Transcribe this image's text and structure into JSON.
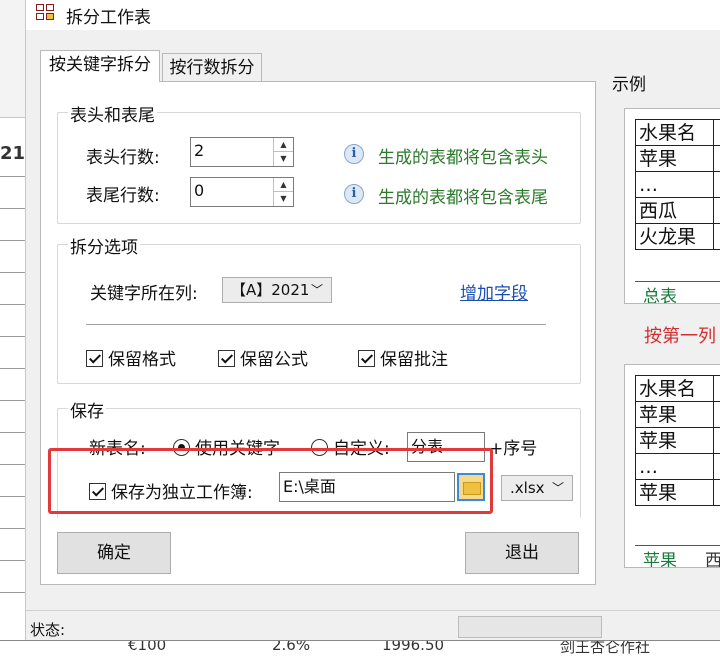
{
  "window": {
    "title": "拆分工作表"
  },
  "tabs": [
    {
      "label": "按关键字拆分",
      "active": true
    },
    {
      "label": "按行数拆分",
      "active": false
    }
  ],
  "header_footer": {
    "title": "表头和表尾",
    "header_rows_label": "表头行数:",
    "header_rows_value": "2",
    "header_hint": "生成的表都将包含表头",
    "footer_rows_label": "表尾行数:",
    "footer_rows_value": "0",
    "footer_hint": "生成的表都将包含表尾"
  },
  "split_options": {
    "title": "拆分选项",
    "key_column_label": "关键字所在列:",
    "key_column_value": "【A】2021",
    "add_field_link": "增加字段",
    "keep_format": "保留格式",
    "keep_formula": "保留公式",
    "keep_comment": "保留批注"
  },
  "save": {
    "title": "保存",
    "new_sheet_name_label": "新表名:",
    "use_keyword": "使用关键字",
    "custom": "自定义:",
    "custom_value": "分表",
    "suffix": "+序号",
    "save_separate_label": "保存为独立工作簿:",
    "path_value": "E:\\桌面",
    "extension": ".xlsx"
  },
  "buttons": {
    "ok": "确定",
    "exit": "退出"
  },
  "status": {
    "label": "状态:"
  },
  "example": {
    "label": "示例",
    "table1_rows": [
      "水果名",
      "苹果",
      "…",
      "西瓜",
      "火龙果"
    ],
    "table1_sheet_tab": "总表",
    "arrow_text": "按第一列",
    "table2_rows": [
      "水果名",
      "苹果",
      "苹果",
      "…",
      "苹果"
    ],
    "table2_sheet_tabs": [
      "苹果",
      "西"
    ]
  },
  "background": {
    "sheet_fragment": "21",
    "bottom_cells": [
      "€100",
      "2.6%",
      "1996.50",
      "剑王杏仑作社"
    ]
  },
  "colors": {
    "hint_green": "#2a7a2a",
    "link_blue": "#1a4fb0",
    "highlight_red": "#e23a3a"
  }
}
